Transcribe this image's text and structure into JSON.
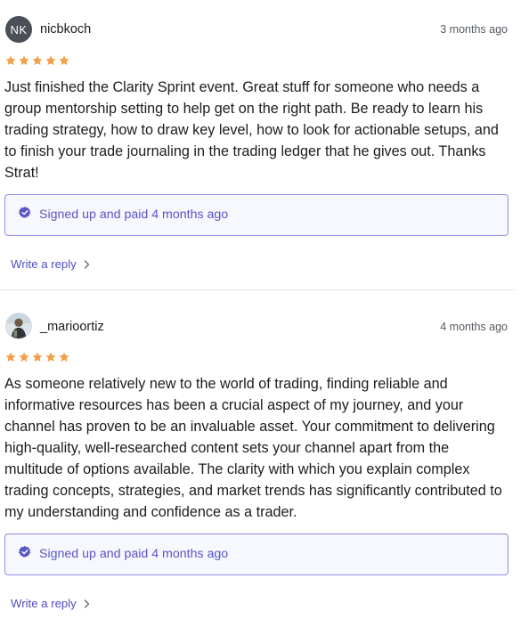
{
  "reviews": [
    {
      "avatar_initials": "NK",
      "avatar_color": "#4b4f57",
      "username": "nicbkoch",
      "time": "3 months ago",
      "rating": 5,
      "text": "Just finished the Clarity Sprint event. Great stuff for someone who needs a group mentorship setting to help get on the right path. Be ready to learn his trading strategy, how to draw key level, how to look for actionable setups, and to finish your trade journaling in the trading ledger that he gives out. Thanks Strat!",
      "badge_icon": "verified-check-icon",
      "badge_text": "Signed up and paid 4 months ago",
      "reply_label": "Write a reply"
    },
    {
      "avatar_icon": "user-photo-avatar",
      "username": "_marioortiz",
      "time": "4 months ago",
      "rating": 5,
      "text": "As someone relatively new to the world of trading, finding reliable and informative resources has been a crucial aspect of my journey, and your channel has proven to be an invaluable asset. Your commitment to delivering high-quality, well-researched content sets your channel apart from the multitude of options available. The clarity with which you explain complex trading concepts, strategies, and market trends has significantly contributed to my understanding and confidence as a trader.",
      "badge_icon": "verified-check-icon",
      "badge_text": "Signed up and paid 4 months ago",
      "reply_label": "Write a reply"
    }
  ],
  "colors": {
    "star": "#f0a04b",
    "accent": "#5855c7",
    "badge_border": "#8f8ee8",
    "badge_bg": "#f7f7fe",
    "divider": "#e4e4e7"
  }
}
